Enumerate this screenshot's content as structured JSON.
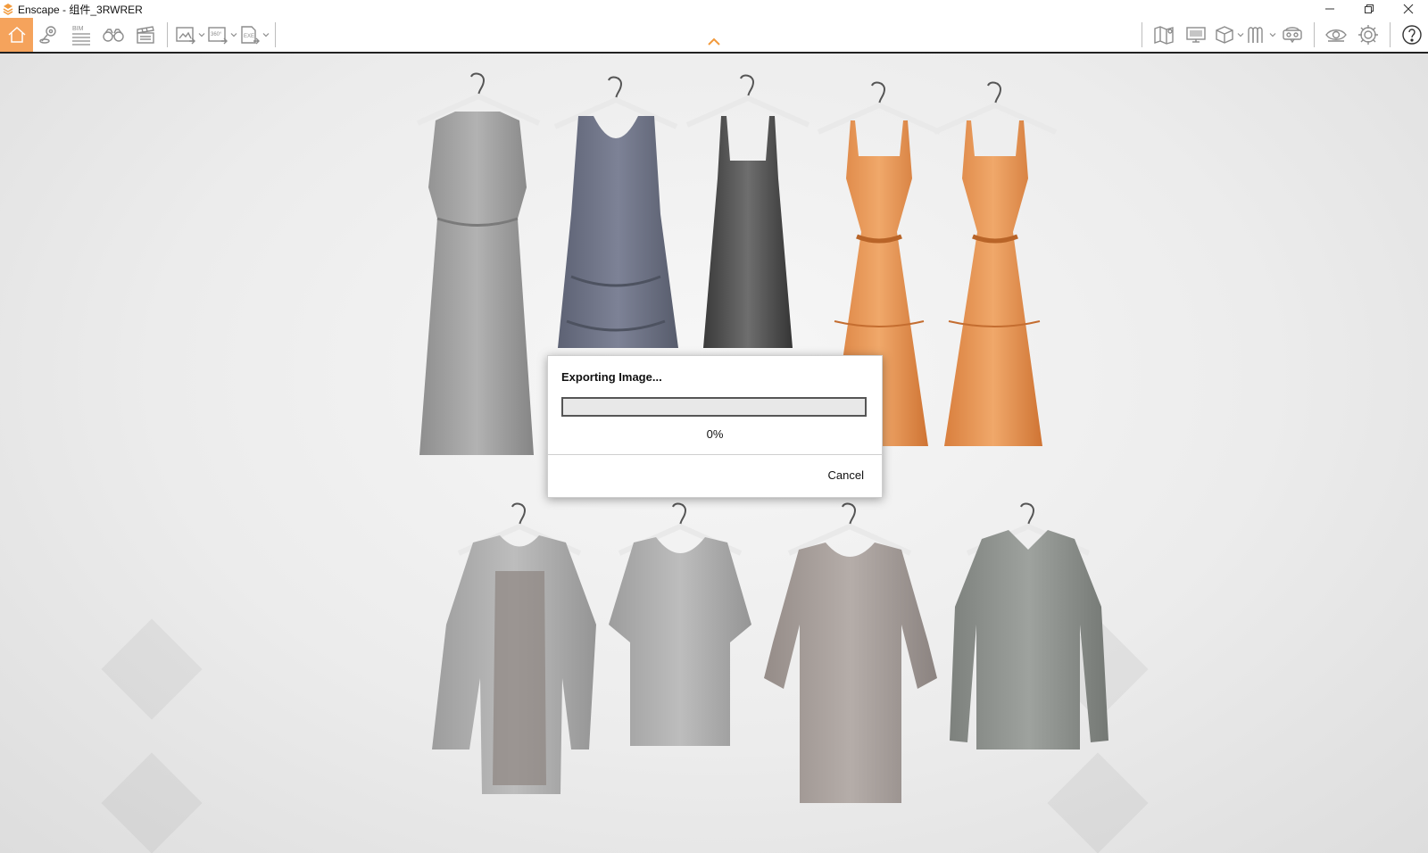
{
  "window": {
    "title": "Enscape - 组件_3RWRER"
  },
  "toolbar": {
    "left_buttons": [
      {
        "name": "home",
        "icon": "home-icon"
      },
      {
        "name": "views",
        "icon": "location-pin-icon"
      },
      {
        "name": "bim",
        "icon": "bim-icon",
        "label": "BIM"
      },
      {
        "name": "visual-settings",
        "icon": "binoculars-icon"
      },
      {
        "name": "video-editor",
        "icon": "clapperboard-icon"
      }
    ],
    "export_buttons": [
      {
        "name": "batch-render",
        "icon": "image-export-icon"
      },
      {
        "name": "panorama",
        "icon": "panorama-360-icon",
        "label": "360°"
      },
      {
        "name": "exe-export",
        "icon": "exe-export-icon",
        "label": "EXE"
      }
    ],
    "right_buttons": [
      {
        "name": "map",
        "icon": "map-icon"
      },
      {
        "name": "monitor",
        "icon": "monitor-icon"
      },
      {
        "name": "asset-library",
        "icon": "cube-icon"
      },
      {
        "name": "materials",
        "icon": "material-icon"
      },
      {
        "name": "vr-headset",
        "icon": "vr-headset-icon"
      },
      {
        "name": "eye",
        "icon": "eye-icon"
      },
      {
        "name": "settings",
        "icon": "gear-icon"
      },
      {
        "name": "help",
        "icon": "help-icon"
      }
    ]
  },
  "dialog": {
    "title": "Exporting Image...",
    "progress": 0,
    "progress_label": "0%",
    "cancel_label": "Cancel"
  },
  "colors": {
    "accent": "#f5a35c",
    "toolbar_icon": "#8c8c8c"
  }
}
